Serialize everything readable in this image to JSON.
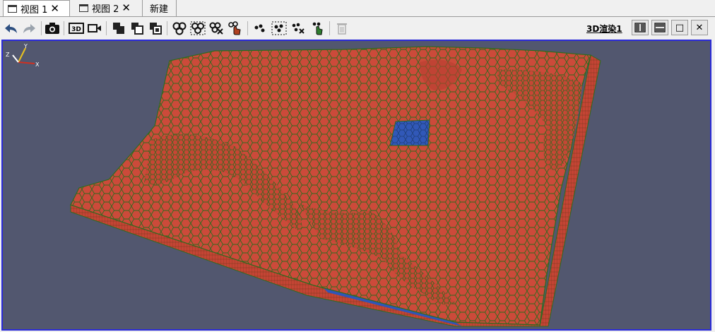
{
  "tabs": [
    {
      "label": "视图 1",
      "close": "✕",
      "active": true
    },
    {
      "label": "视图 2",
      "close": "✕",
      "active": false
    },
    {
      "label": "新建"
    }
  ],
  "toolbar": {
    "render_label": "3D渲染1",
    "restore_icon": "□",
    "close_icon": "✕",
    "threeD_label": "3D"
  },
  "axes": {
    "z": "Z",
    "y": "Y",
    "x": "X"
  },
  "colors": {
    "mesh_fill": "#cc4a3a",
    "mesh_line": "#2f6b1f",
    "selected": "#2f55b8",
    "background": "#52576f",
    "frame": "#2b2bd8"
  }
}
